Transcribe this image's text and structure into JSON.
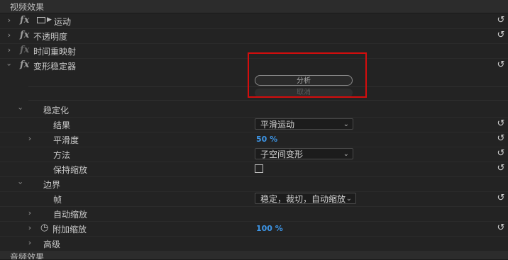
{
  "panel": {
    "video_effects_title": "视频效果",
    "audio_effects_title": "音频效果"
  },
  "effects": {
    "motion": "运动",
    "opacity": "不透明度",
    "time_remap": "时间重映射",
    "warp_stabilizer": "变形稳定器",
    "fx_symbol": "fx"
  },
  "warp": {
    "analyze_label": "分析",
    "cancel_label": "取消"
  },
  "stabilization": {
    "group_label": "稳定化",
    "result_label": "结果",
    "result_value": "平滑运动",
    "smoothness_label": "平滑度",
    "smoothness_value": "50 %",
    "method_label": "方法",
    "method_value": "子空间变形",
    "preserve_scale_label": "保持缩放",
    "preserve_scale_checked": false
  },
  "borders": {
    "group_label": "边界",
    "framing_label": "帧",
    "framing_value": "稳定，裁切，自动缩放",
    "auto_scale_label": "自动缩放",
    "additional_scale_label": "附加缩放",
    "additional_scale_value": "100 %"
  },
  "advanced": {
    "label": "高级"
  },
  "colors": {
    "value_blue": "#3d95e6",
    "highlight_red": "#d40d0d"
  }
}
